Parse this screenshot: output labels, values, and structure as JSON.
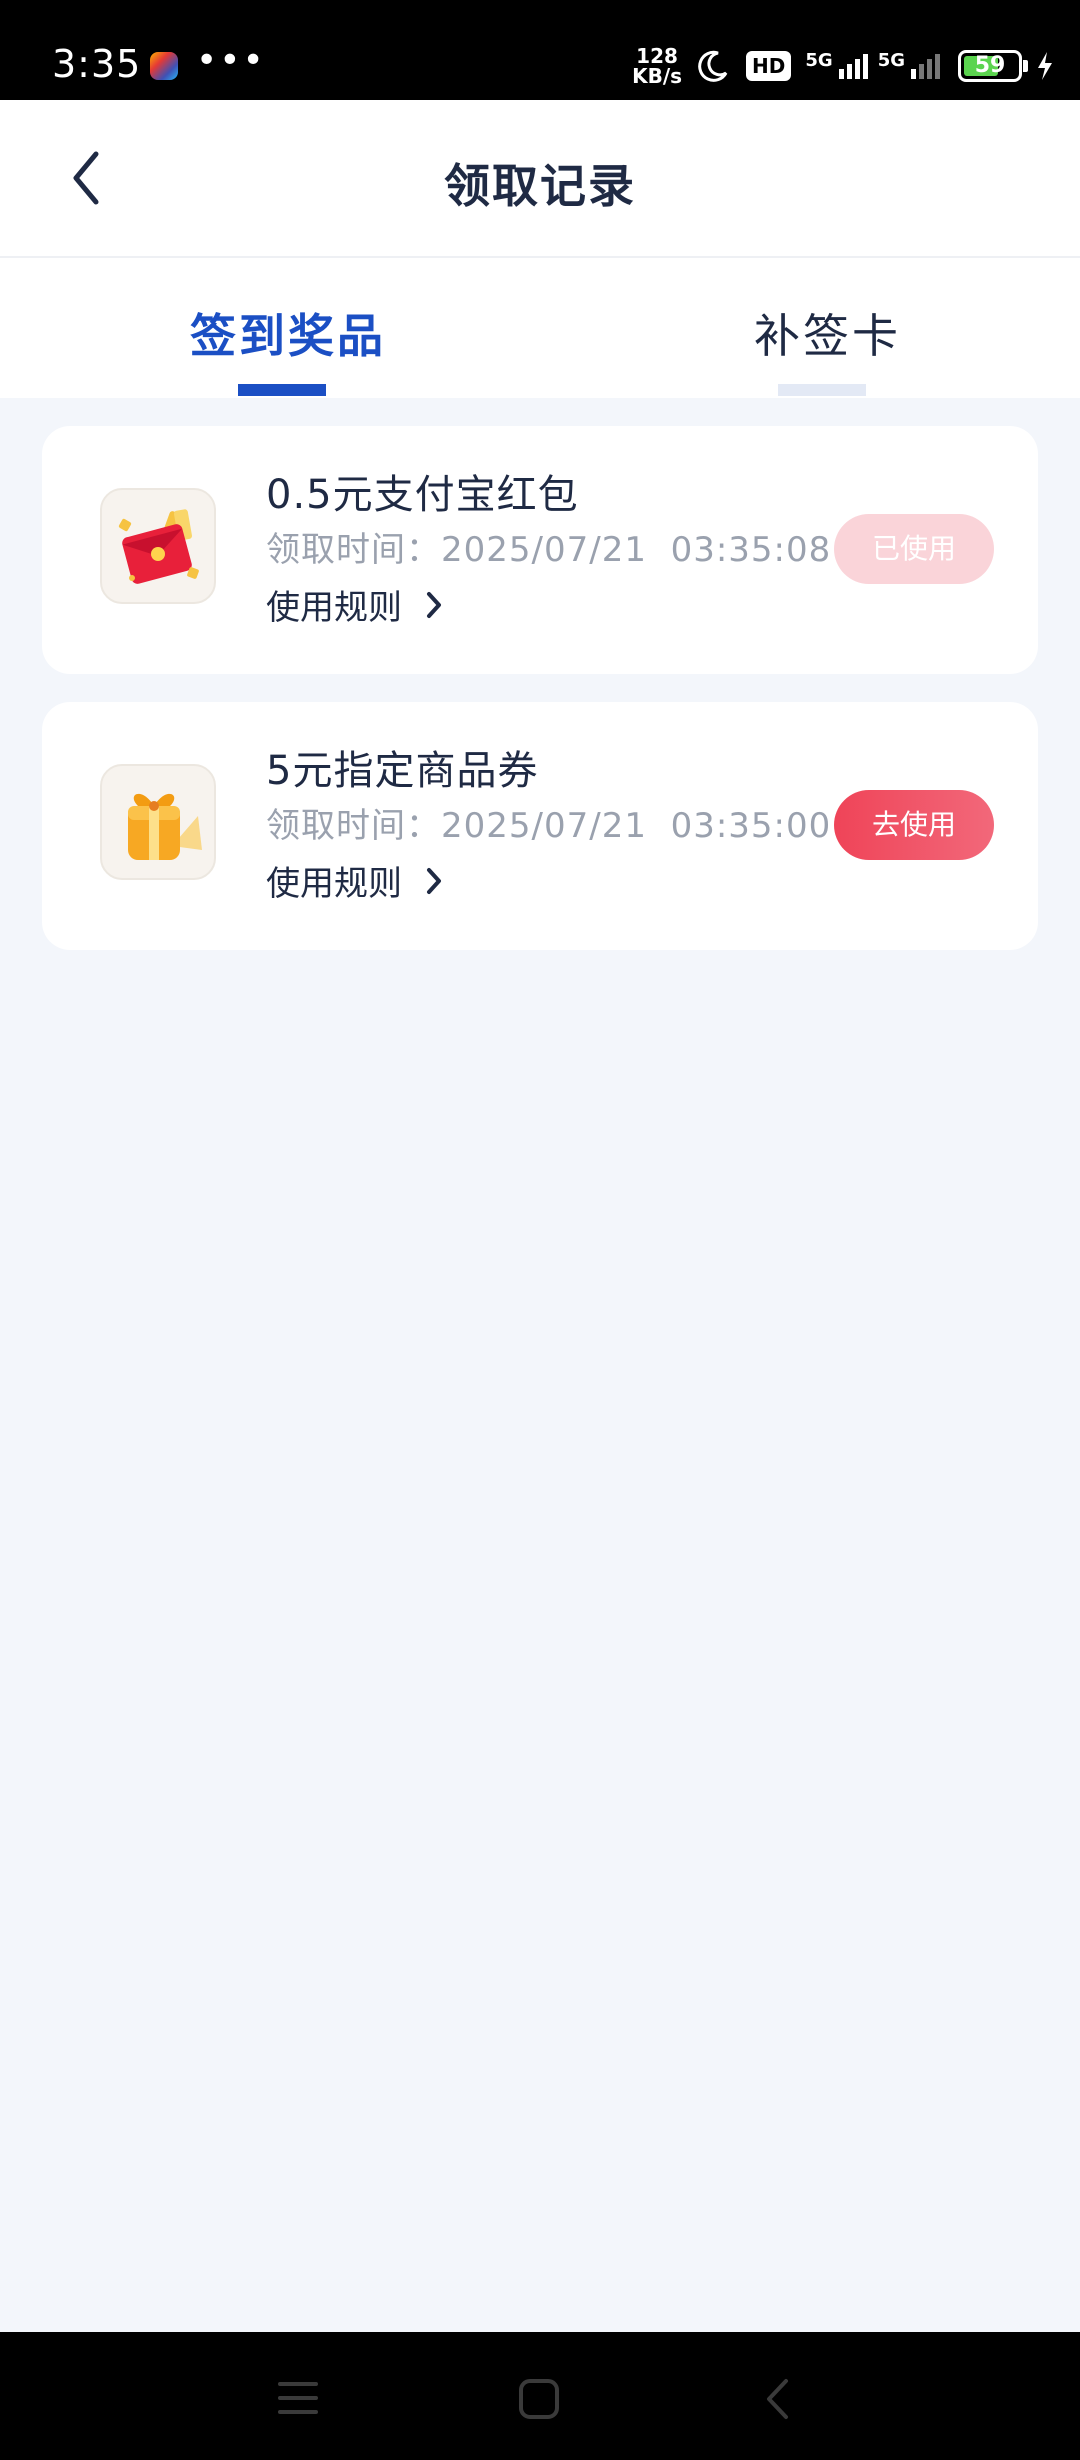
{
  "status_bar": {
    "time": "3:35",
    "more": "•••",
    "net_speed_value": "128",
    "net_speed_unit": "KB/s",
    "hd_badge": "HD",
    "network_1": "5G",
    "network_2": "5G",
    "battery": "59"
  },
  "header": {
    "title": "领取记录",
    "back_icon": "chevron-left-icon"
  },
  "tabs": [
    {
      "label": "签到奖品",
      "active": true
    },
    {
      "label": "补签卡",
      "active": false
    }
  ],
  "records": [
    {
      "name": "0.5元支付宝红包",
      "time": "领取时间：2025/07/21  03:35:08",
      "rules_label": "使用规则",
      "action": "已使用",
      "action_state": "used",
      "icon": "red-envelope-icon"
    },
    {
      "name": "5元指定商品券",
      "time": "领取时间：2025/07/21  03:35:00",
      "rules_label": "使用规则",
      "action": "去使用",
      "action_state": "available",
      "icon": "gift-package-icon"
    }
  ],
  "colors": {
    "accent": "#1b4fc4",
    "title": "#1f2a44",
    "muted": "#9aa1ae",
    "page_bg": "#f3f6fb",
    "button_active": "#ef4458",
    "button_used": "#fad4d9"
  }
}
